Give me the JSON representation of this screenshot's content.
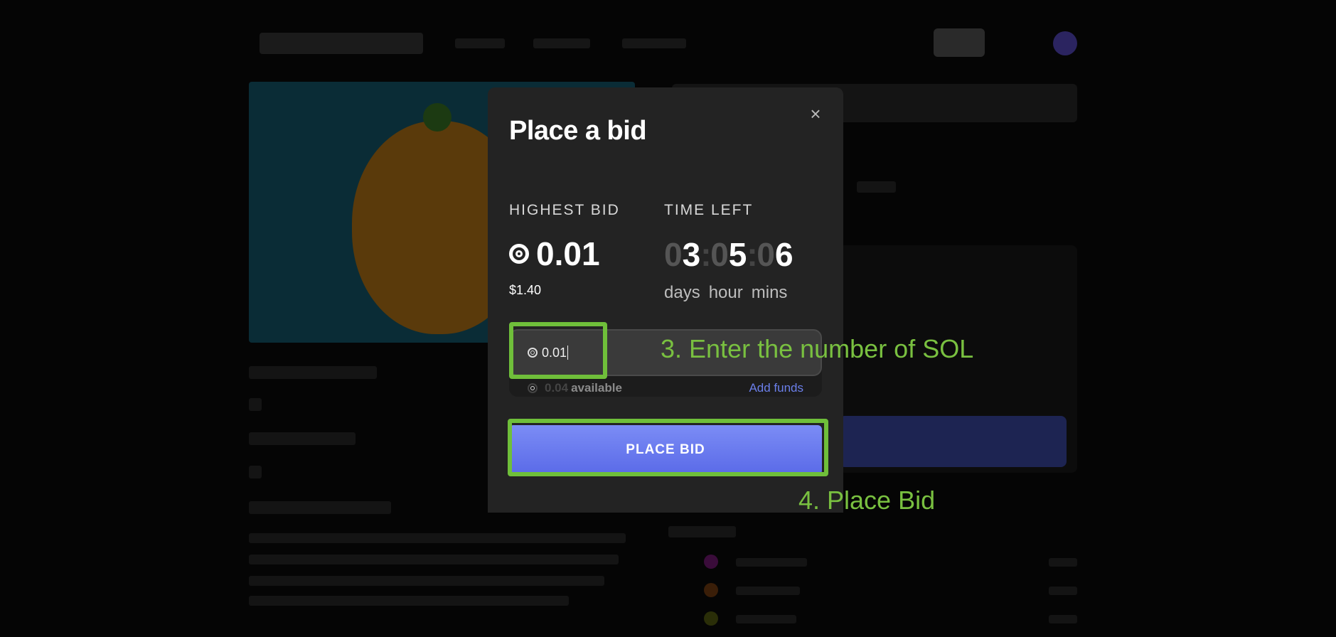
{
  "modal": {
    "title": "Place a bid",
    "close_icon": "close-icon",
    "highest_bid_label": "HIGHEST BID",
    "highest_bid_value": "0.01",
    "highest_bid_usd": "$1.40",
    "time_left_label": "TIME LEFT",
    "timer": {
      "days_dim": "0",
      "days": "3",
      "sep1": ":",
      "hours_dim": "0",
      "hours": "5",
      "sep2": ":",
      "mins_dim": "0",
      "mins": "6"
    },
    "units": {
      "days": "days",
      "hour": "hour",
      "mins": "mins"
    },
    "bid_input_value": "0.01",
    "available_amount": "0.04",
    "available_label": "available",
    "add_funds_label": "Add funds",
    "place_bid_label": "PLACE BID"
  },
  "annotations": {
    "step3": "3. Enter the number of SOL",
    "step4": "4. Place Bid",
    "highlight_color": "#6fbf3a"
  },
  "icons": {
    "currency": "sol-icon"
  }
}
